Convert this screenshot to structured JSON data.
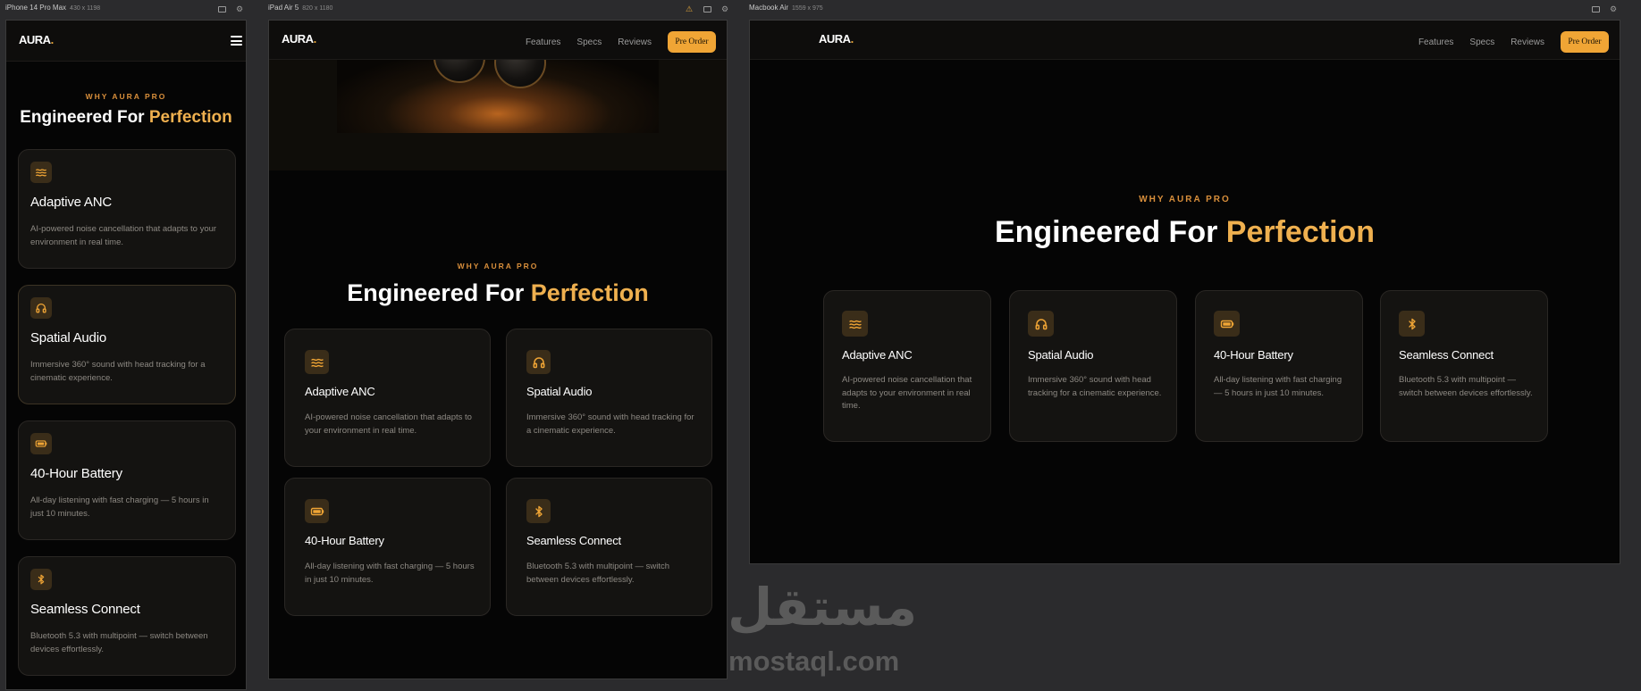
{
  "devices": [
    {
      "name": "iPhone 14 Pro Max",
      "dims": "430 x 1198"
    },
    {
      "name": "iPad Air 5",
      "dims": "820 x 1180"
    },
    {
      "name": "Macbook Air",
      "dims": "1559 x 975"
    }
  ],
  "brand": {
    "logo": "AURA",
    "logo_dot": ".",
    "accent_color": "#efb04f",
    "button_color": "#f0a535"
  },
  "nav": {
    "links": [
      "Features",
      "Specs",
      "Reviews"
    ],
    "cta": "Pre Order"
  },
  "section": {
    "eyebrow": "WHY AURA PRO",
    "headline_main": "Engineered For",
    "headline_accent": "Perfection"
  },
  "features": [
    {
      "icon": "waves-icon",
      "title": "Adaptive ANC",
      "desc": "AI-powered noise cancellation that adapts to your environment in real time."
    },
    {
      "icon": "headphones-icon",
      "title": "Spatial Audio",
      "desc": "Immersive 360° sound with head tracking for a cinematic experience."
    },
    {
      "icon": "battery-icon",
      "title": "40-Hour Battery",
      "desc": "All-day listening with fast charging — 5 hours in just 10 minutes."
    },
    {
      "icon": "bluetooth-icon",
      "title": "Seamless Connect",
      "desc": "Bluetooth 5.3 with multipoint — switch between devices effortlessly."
    }
  ],
  "watermark": {
    "arabic": "مستقل",
    "latin": "mostaql.com"
  }
}
